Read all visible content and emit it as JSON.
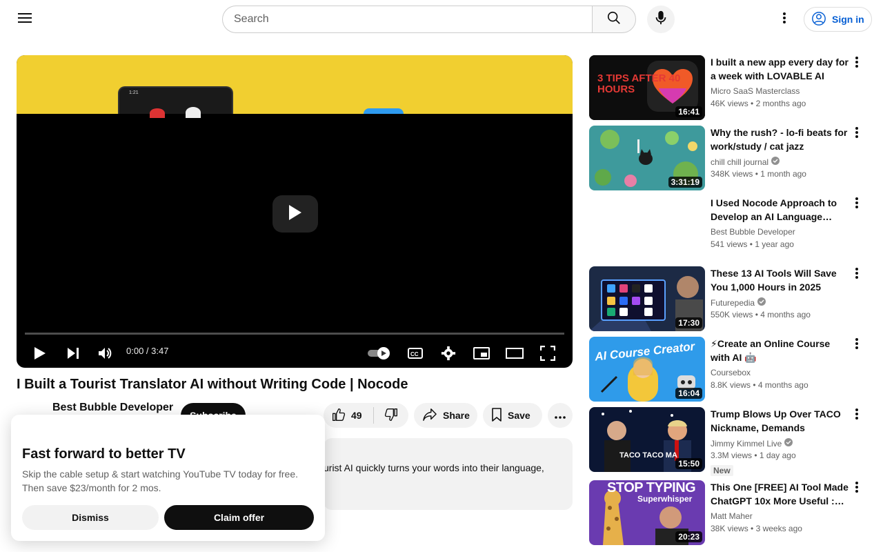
{
  "header": {
    "search_placeholder": "Search",
    "signin_label": "Sign in"
  },
  "player": {
    "time": "0:00 / 3:47",
    "preview_phone_time": "1:21",
    "progress_fraction": 0
  },
  "video": {
    "title": "I Built a Tourist Translator AI without Writing Code | Nocode",
    "channel": "Best Bubble Developer",
    "subscribe_label": "Subscribe",
    "like_count": "49",
    "share_label": "Share",
    "save_label": "Save",
    "description": "urist AI quickly turns your words into their language,"
  },
  "promo": {
    "title": "Fast forward to better TV",
    "body": "Skip the cable setup & start watching YouTube TV today for free. Then save $23/month for 2 mos.",
    "dismiss_label": "Dismiss",
    "claim_label": "Claim offer"
  },
  "recommendations": [
    {
      "title": "I built a new app every day for a week with LOVABLE AI",
      "channel": "Micro SaaS Masterclass",
      "verified": false,
      "views": "46K views",
      "age": "2 months ago",
      "duration": "16:41",
      "thumb_text": "3 TIPS AFTER 40 HOURS",
      "badge": ""
    },
    {
      "title": "Why the rush? - lo-fi beats for work/study / cat jazz",
      "channel": "chill chill journal",
      "verified": true,
      "views": "348K views",
      "age": "1 month ago",
      "duration": "3:31:19",
      "thumb_text": "",
      "badge": ""
    },
    {
      "title": "I Used Nocode Approach to Develop an AI Language…",
      "channel": "Best Bubble Developer",
      "verified": false,
      "views": "541 views",
      "age": "1 year ago",
      "duration": "",
      "thumb_text": "",
      "badge": ""
    },
    {
      "title": "These 13 AI Tools Will Save You 1,000 Hours in 2025",
      "channel": "Futurepedia",
      "verified": true,
      "views": "550K views",
      "age": "4 months ago",
      "duration": "17:30",
      "thumb_text": "",
      "badge": ""
    },
    {
      "title": "⚡Create an Online Course with AI 🤖",
      "channel": "Coursebox",
      "verified": false,
      "views": "8.8K views",
      "age": "4 months ago",
      "duration": "16:04",
      "thumb_text": "AI Course Creator",
      "badge": ""
    },
    {
      "title": "Trump Blows Up Over TACO Nickname, Demands Apology…",
      "channel": "Jimmy Kimmel Live",
      "verified": true,
      "views": "3.3M views",
      "age": "1 day ago",
      "duration": "15:50",
      "thumb_text": "TACO TACO MA",
      "badge": "New"
    },
    {
      "title": "This One [FREE] AI Tool Made ChatGPT 10x More Useful :…",
      "channel": "Matt Maher",
      "verified": false,
      "views": "38K views",
      "age": "3 weeks ago",
      "duration": "20:23",
      "thumb_text": "STOP TYPING",
      "thumb_sub": "Superwhisper",
      "badge": ""
    }
  ],
  "colors": {
    "accent_link": "#065fd4",
    "player_preview_yellow": "#f1cf30"
  }
}
